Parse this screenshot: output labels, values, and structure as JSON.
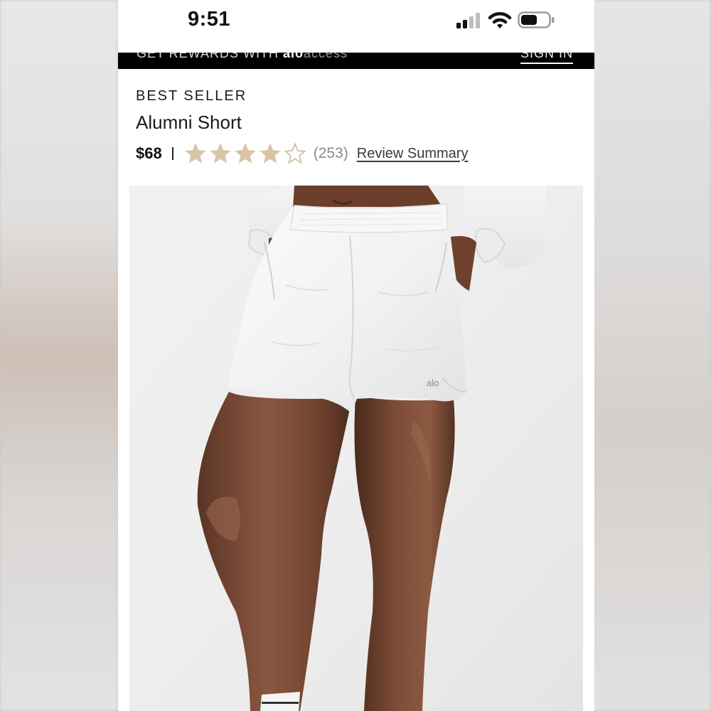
{
  "status_bar": {
    "time": "9:51",
    "icons": [
      "cellular-signal-icon",
      "wifi-icon",
      "battery-icon"
    ]
  },
  "promo_banner": {
    "text": "GET REWARDS WITH ",
    "brand": "alo",
    "brand_suffix": "access",
    "action": "SIGN IN"
  },
  "product": {
    "badge": "BEST SELLER",
    "title": "Alumni Short",
    "price": "$68",
    "rating": 4,
    "rating_max": 5,
    "review_count": "(253)",
    "review_link": "Review Summary",
    "image_logo": "alo"
  },
  "colors": {
    "star_filled": "#d9c4a5",
    "star_empty": "#c9b89c",
    "banner": "#000000",
    "text": "#1a1a1a"
  }
}
